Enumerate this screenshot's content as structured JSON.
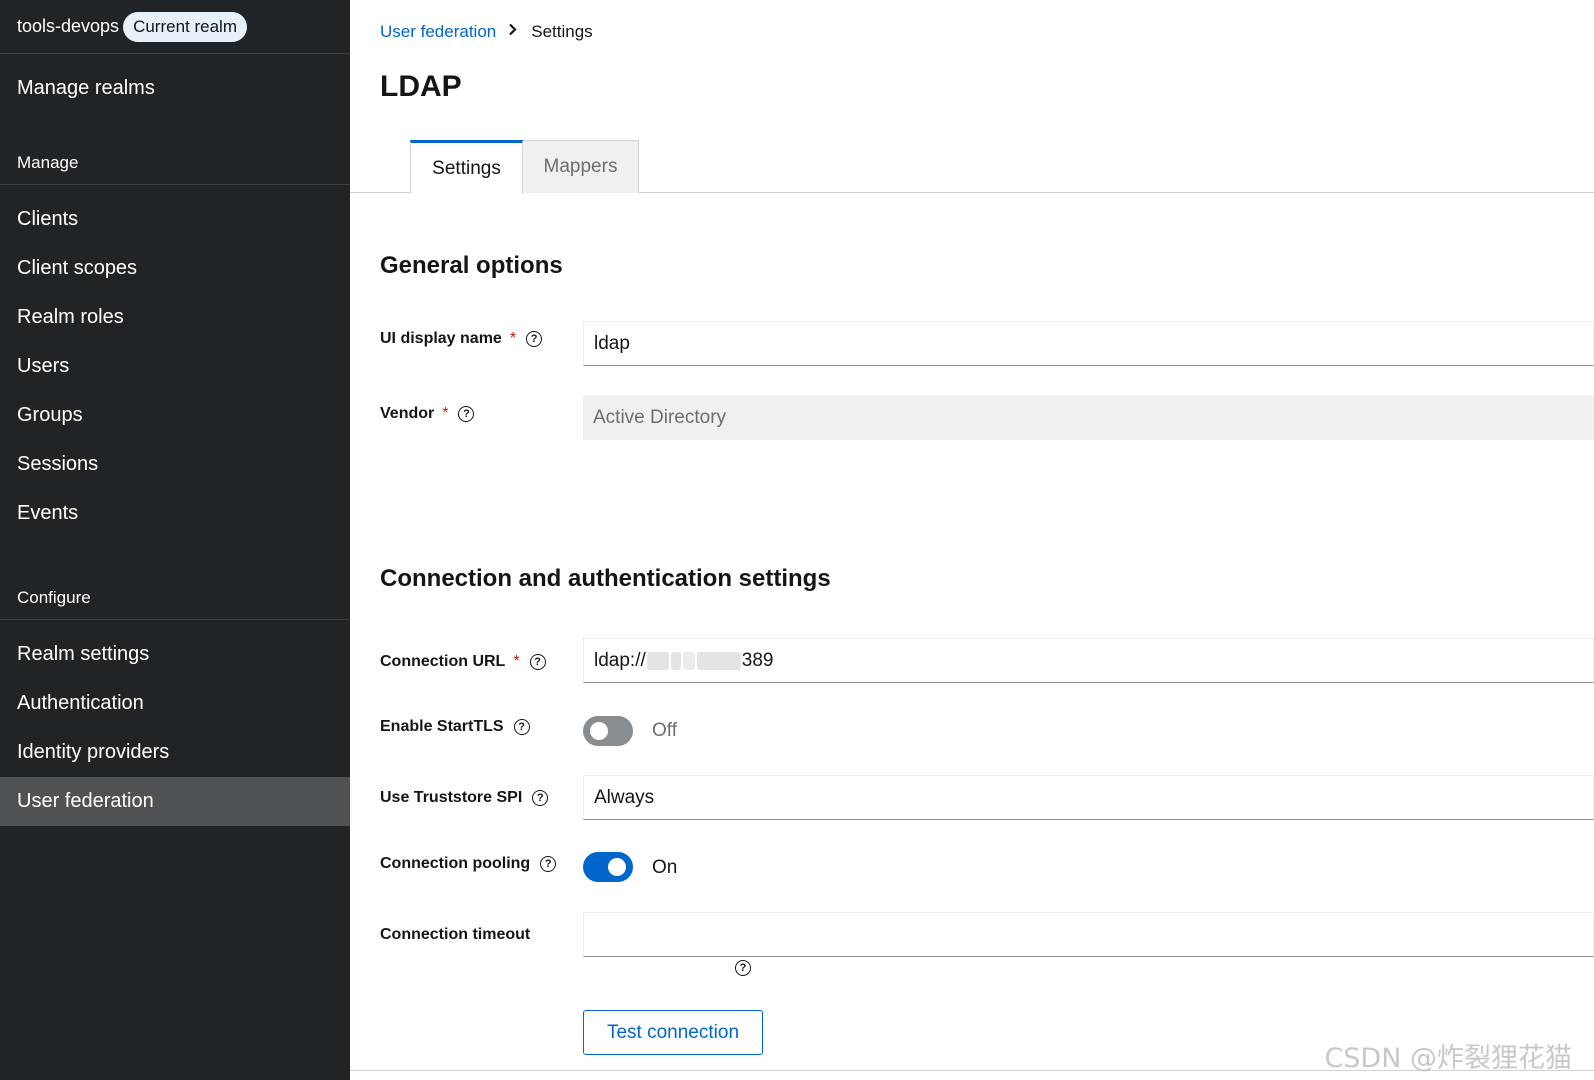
{
  "sidebar": {
    "realm_name": "tools-devops",
    "realm_badge": "Current realm",
    "manage_realms": "Manage realms",
    "manage_title": "Manage",
    "manage_items": [
      "Clients",
      "Client scopes",
      "Realm roles",
      "Users",
      "Groups",
      "Sessions",
      "Events"
    ],
    "configure_title": "Configure",
    "configure_items": [
      "Realm settings",
      "Authentication",
      "Identity providers",
      "User federation"
    ],
    "active_item": "User federation"
  },
  "breadcrumb": {
    "parent": "User federation",
    "current": "Settings"
  },
  "page": {
    "title": "LDAP"
  },
  "tabs": {
    "settings": "Settings",
    "mappers": "Mappers",
    "active": "Settings"
  },
  "general": {
    "heading": "General options",
    "ui_display_name_label": "UI display name",
    "ui_display_name_value": "ldap",
    "vendor_label": "Vendor",
    "vendor_value": "Active Directory"
  },
  "connection": {
    "heading": "Connection and authentication settings",
    "url_label": "Connection URL",
    "url_prefix": "ldap://",
    "url_suffix": "389",
    "starttls_label": "Enable StartTLS",
    "starttls_state": "Off",
    "truststore_label": "Use Truststore SPI",
    "truststore_value": "Always",
    "pooling_label": "Connection pooling",
    "pooling_state": "On",
    "timeout_label": "Connection timeout",
    "timeout_value": "",
    "test_button": "Test connection"
  },
  "common": {
    "required_mark": "*",
    "help_glyph": "?"
  },
  "watermark": "CSDN @炸裂狸花猫",
  "colors": {
    "sidebar_bg": "#212427",
    "sidebar_active": "#4f5255",
    "link_blue": "#0066cc",
    "switch_on": "#0066cc",
    "switch_off": "#8a8d90",
    "required_red": "#c9190b"
  }
}
